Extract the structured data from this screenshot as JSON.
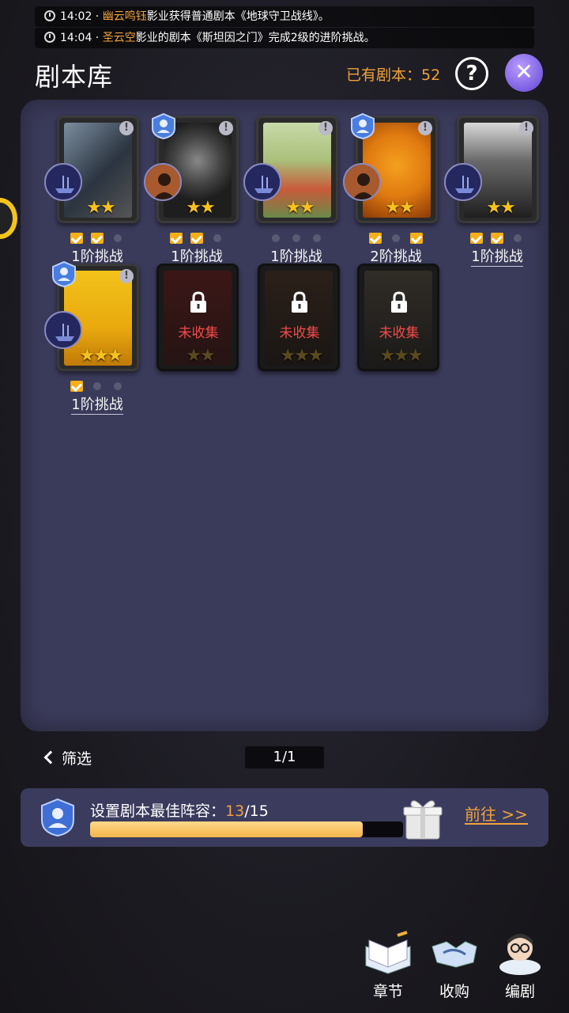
{
  "ticker": [
    {
      "time": "14:02",
      "name": "幽云鸣钰",
      "text": "影业获得普通剧本《地球守卫战线》。"
    },
    {
      "time": "14:04",
      "name": "圣云空",
      "text": "影业的剧本《斯坦因之门》完成2级的进阶挑战。"
    }
  ],
  "header": {
    "title": "剧本库",
    "owned_label": "已有剧本：",
    "owned_count": "52",
    "help_icon": "?",
    "close_icon": "✕"
  },
  "cards": [
    {
      "stars": "★★",
      "challenge": "1阶挑战",
      "checks": [
        true,
        true,
        false
      ],
      "info": "!"
    },
    {
      "stars": "★★",
      "challenge": "1阶挑战",
      "checks": [
        true,
        true,
        false
      ],
      "info": "!"
    },
    {
      "stars": "★★",
      "challenge": "1阶挑战",
      "checks": [
        false,
        false,
        false
      ],
      "info": "!"
    },
    {
      "stars": "★★",
      "challenge": "2阶挑战",
      "checks": [
        true,
        false,
        true
      ],
      "info": "!"
    },
    {
      "stars": "★★",
      "challenge": "1阶挑战",
      "checks": [
        true,
        true,
        false
      ],
      "info": "!"
    },
    {
      "stars": "★★★",
      "challenge": "1阶挑战",
      "checks": [
        true,
        false,
        false
      ],
      "info": "!"
    }
  ],
  "locked_cards": [
    {
      "label": "未收集",
      "stars": "★★"
    },
    {
      "label": "未收集",
      "stars": "★★★"
    },
    {
      "label": "未收集",
      "stars": "★★★"
    }
  ],
  "footer": {
    "filter_label": "筛选",
    "page": "1/1"
  },
  "lineup": {
    "label": "设置剧本最佳阵容：",
    "current": "13",
    "total": "/15",
    "progress_fraction": 0.87,
    "goto": "前往 >>"
  },
  "bottom_nav": [
    {
      "label": "章节",
      "icon": "book-icon"
    },
    {
      "label": "收购",
      "icon": "handshake-icon"
    },
    {
      "label": "编剧",
      "icon": "writer-avatar-icon"
    }
  ]
}
